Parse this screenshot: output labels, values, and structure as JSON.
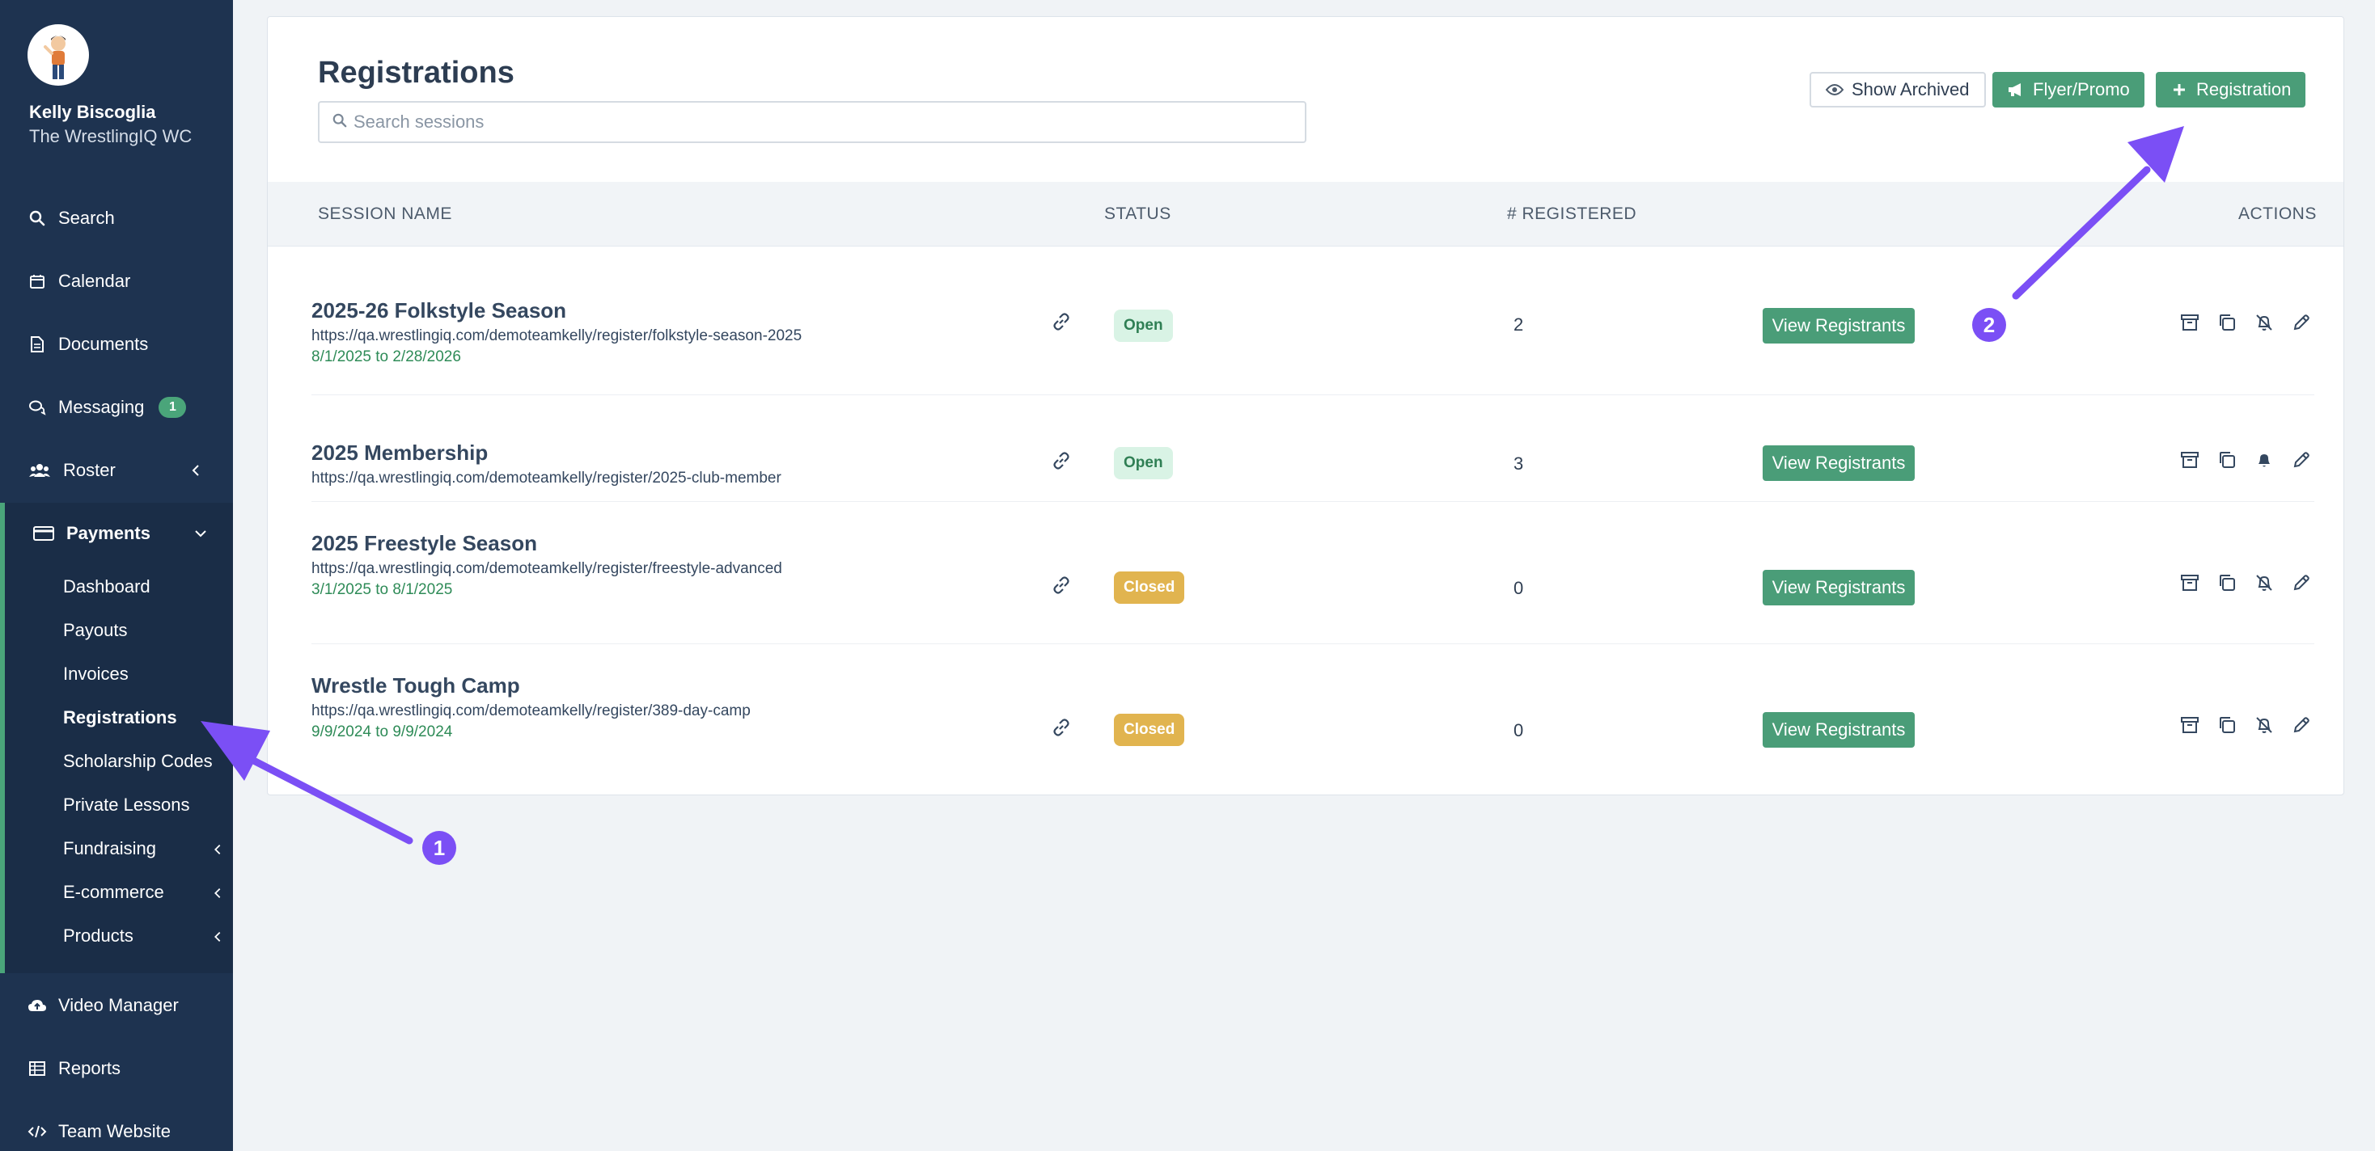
{
  "user": {
    "name": "Kelly Biscoglia",
    "team": "The WrestlingIQ WC"
  },
  "nav": {
    "search": "Search",
    "calendar": "Calendar",
    "documents": "Documents",
    "messaging": "Messaging",
    "messaging_count": "1",
    "roster": "Roster",
    "payments": "Payments",
    "payments_sub": {
      "dashboard": "Dashboard",
      "payouts": "Payouts",
      "invoices": "Invoices",
      "registrations": "Registrations",
      "scholarship_codes": "Scholarship Codes",
      "private_lessons": "Private Lessons",
      "fundraising": "Fundraising",
      "ecommerce": "E-commerce",
      "products": "Products"
    },
    "video_manager": "Video Manager",
    "reports": "Reports",
    "team_website": "Team Website"
  },
  "page": {
    "title": "Registrations",
    "search_placeholder": "Search sessions",
    "show_archived": "Show Archived",
    "flyer_promo": "Flyer/Promo",
    "add_registration": "Registration"
  },
  "table": {
    "headers": {
      "session_name": "SESSION NAME",
      "status": "STATUS",
      "registered": "# REGISTERED",
      "actions": "ACTIONS"
    },
    "view_label": "View Registrants",
    "rows": [
      {
        "name": "2025-26 Folkstyle Season",
        "url": "https://qa.wrestlingiq.com/demoteamkelly/register/folkstyle-season-2025",
        "dates": "8/1/2025 to 2/28/2026",
        "status": "Open",
        "registered": "2"
      },
      {
        "name": "2025 Membership",
        "url": "https://qa.wrestlingiq.com/demoteamkelly/register/2025-club-member",
        "dates": "",
        "status": "Open",
        "registered": "3"
      },
      {
        "name": "2025 Freestyle Season",
        "url": "https://qa.wrestlingiq.com/demoteamkelly/register/freestyle-advanced",
        "dates": "3/1/2025 to 8/1/2025",
        "status": "Closed",
        "registered": "0"
      },
      {
        "name": "Wrestle Tough Camp",
        "url": "https://qa.wrestlingiq.com/demoteamkelly/register/389-day-camp",
        "dates": "9/9/2024 to 9/9/2024",
        "status": "Closed",
        "registered": "0"
      }
    ]
  },
  "annotations": {
    "marker_1": "1",
    "marker_2": "2"
  },
  "colors": {
    "sidebar": "#1e3350",
    "accent_green": "#4a9d78",
    "annotation": "#7b4ff5",
    "closed": "#e1b44f"
  }
}
